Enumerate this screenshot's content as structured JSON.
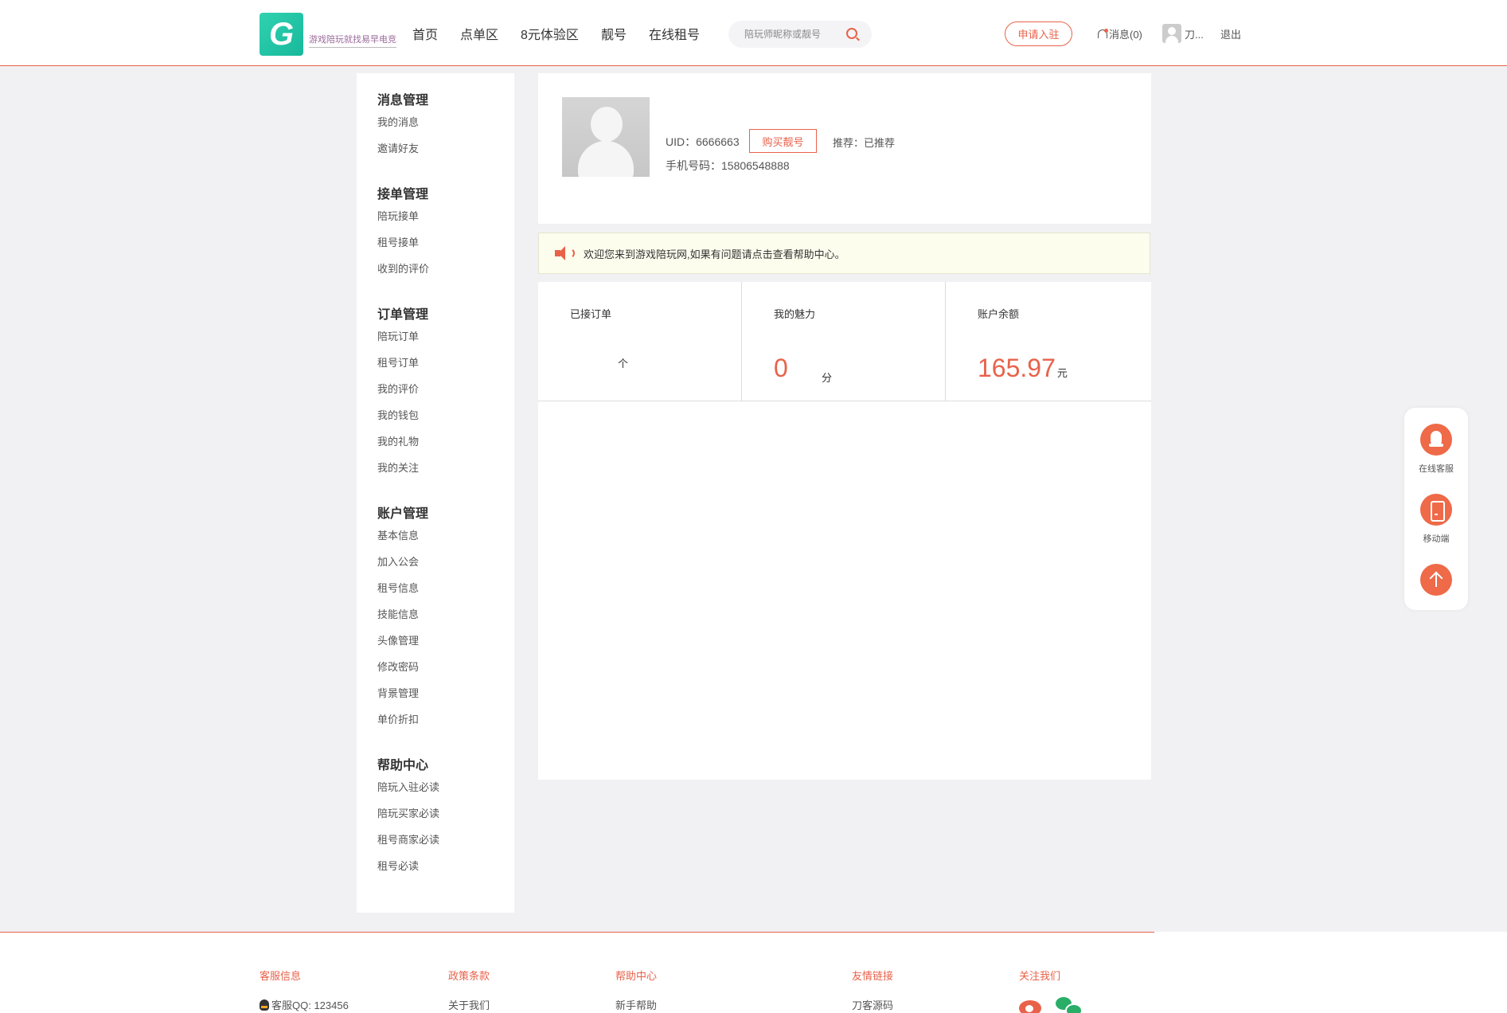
{
  "header": {
    "logo_text": "游戏陪玩就找易早电竞",
    "nav": [
      "首页",
      "点单区",
      "8元体验区",
      "靓号",
      "在线租号"
    ],
    "search_placeholder": "陪玩师昵称或靓号",
    "apply_label": "申请入驻",
    "messages_label": "消息(0)",
    "user_name": "刀...",
    "logout_label": "退出"
  },
  "sidebar": {
    "groups": [
      {
        "title": "消息管理",
        "items": [
          "我的消息",
          "邀请好友"
        ]
      },
      {
        "title": "接单管理",
        "items": [
          "陪玩接单",
          "租号接单",
          "收到的评价"
        ]
      },
      {
        "title": "订单管理",
        "items": [
          "陪玩订单",
          "租号订单",
          "我的评价",
          "我的钱包",
          "我的礼物",
          "我的关注"
        ]
      },
      {
        "title": "账户管理",
        "items": [
          "基本信息",
          "加入公会",
          "租号信息",
          "技能信息",
          "头像管理",
          "修改密码",
          "背景管理",
          "单价折扣"
        ]
      },
      {
        "title": "帮助中心",
        "items": [
          "陪玩入驻必读",
          "陪玩买家必读",
          "租号商家必读",
          "租号必读"
        ]
      }
    ]
  },
  "profile": {
    "uid": "UID：6666663",
    "buy_label": "购买靓号",
    "recommend": "推荐：已推荐",
    "phone": "手机号码：15806548888"
  },
  "notice": {
    "text": "欢迎您来到游戏陪玩网,如果有问题请点击查看帮助中心。"
  },
  "stats": {
    "orders_label": "已接订单",
    "orders_value": "",
    "orders_unit": "个",
    "charm_label": "我的魅力",
    "charm_value": "0",
    "charm_unit": "分",
    "balance_label": "账户余额",
    "balance_value": "165.97",
    "balance_unit": "元"
  },
  "float_bar": {
    "service_label": "在线客服",
    "mobile_label": "移动端"
  },
  "footer": {
    "service_title": "客服信息",
    "service_qq": "客服QQ: 123456",
    "policy_title": "政策条款",
    "policy_item": "关于我们",
    "help_title": "帮助中心",
    "help_item": "新手帮助",
    "links_title": "友情链接",
    "links_item": "刀客源码",
    "follow_title": "关注我们"
  },
  "colors": {
    "accent": "#e8624a",
    "logo": "#2fd2b0"
  }
}
